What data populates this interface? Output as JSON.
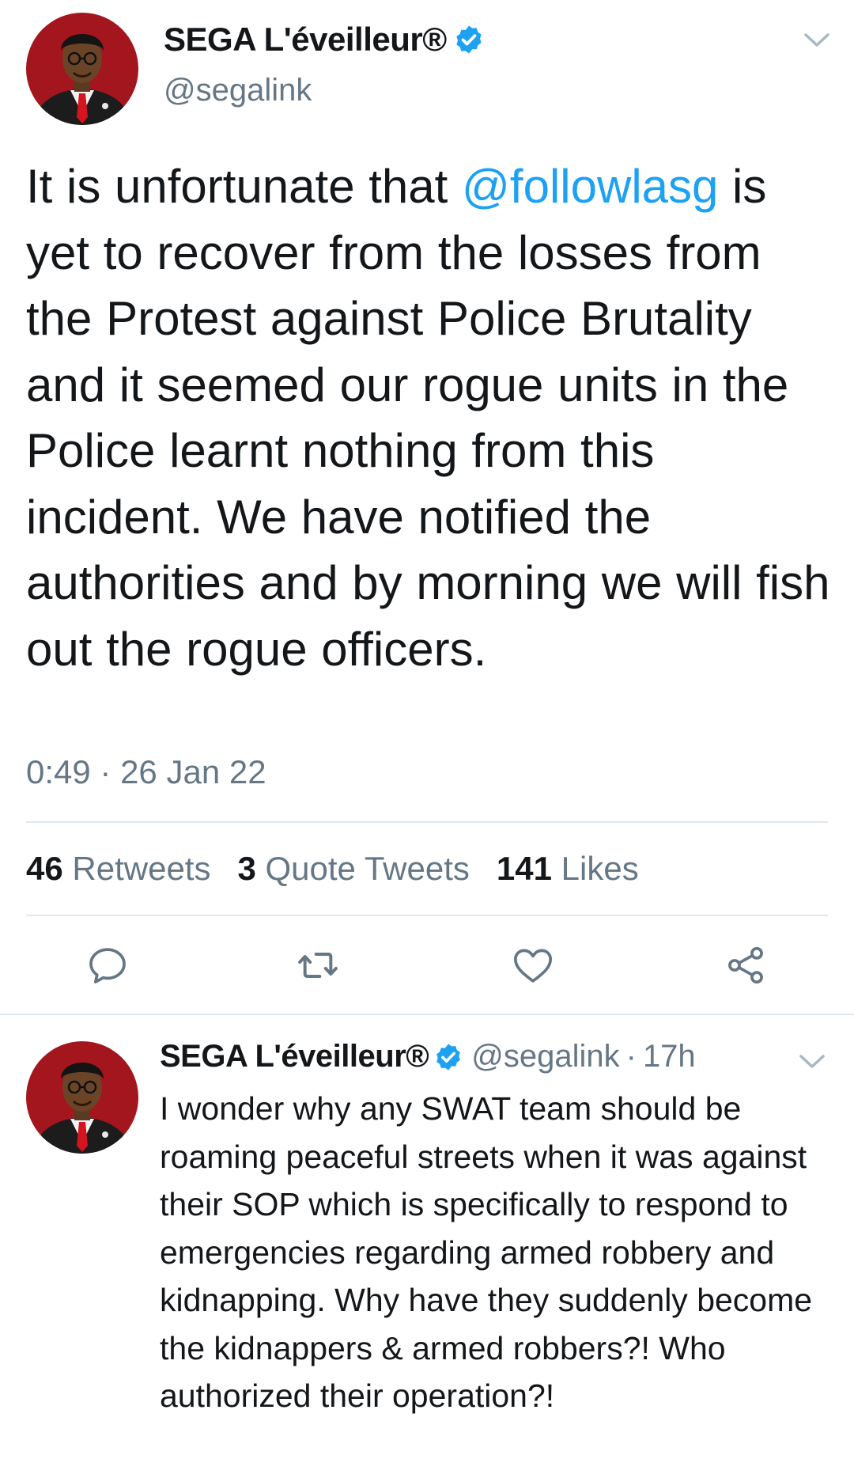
{
  "main_tweet": {
    "display_name": "SEGA L'éveilleur®",
    "handle": "@segalink",
    "body_prefix": "It is unfortunate that ",
    "mention": "@followlasg",
    "body_suffix": " is yet to recover from the losses from the Protest against Police Brutality and it seemed our rogue units in the Police learnt nothing from this incident. We have notified the authorities and by morning we will fish out the rogue officers.",
    "timestamp": "0:49 · 26 Jan 22",
    "stats": {
      "retweets_count": "46",
      "retweets_label": "Retweets",
      "quotes_count": "3",
      "quotes_label": "Quote Tweets",
      "likes_count": "141",
      "likes_label": "Likes"
    },
    "icons": {
      "reply": "reply-icon",
      "retweet": "retweet-icon",
      "like": "like-icon",
      "share": "share-icon",
      "verified": "verified-badge-icon",
      "menu": "chevron-down-icon"
    }
  },
  "reply_tweet": {
    "display_name": "SEGA L'éveilleur®",
    "handle": "@segalink",
    "separator": "·",
    "time": "17h",
    "body": "I wonder why any SWAT team should be roaming peaceful streets when it was against their SOP which is specifically to respond to emergencies regarding armed robbery and kidnapping. Why have they suddenly become the kidnappers & armed robbers?! Who authorized their operation?!"
  },
  "colors": {
    "accent": "#1da1f2",
    "text": "#14171a",
    "muted": "#657786",
    "divider": "#e1e8ed",
    "avatar_bg": "#a3161e"
  }
}
